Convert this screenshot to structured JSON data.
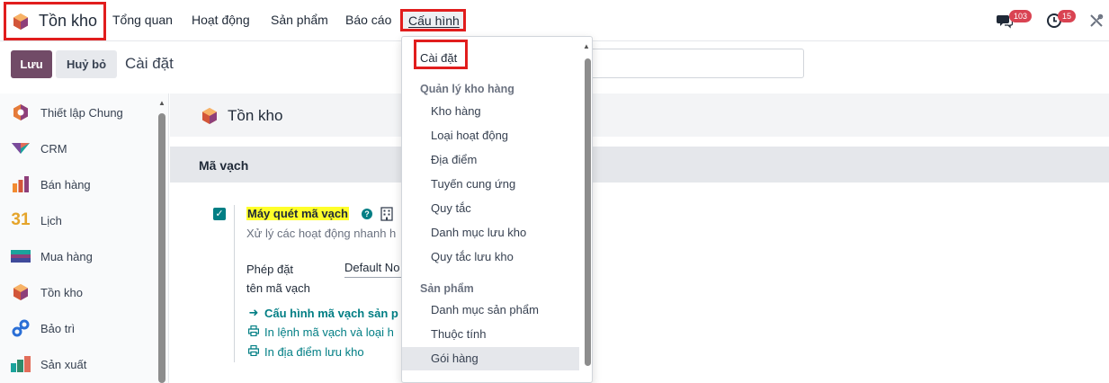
{
  "topbar": {
    "app_name": "Tồn kho",
    "menu": [
      "Tổng quan",
      "Hoạt động",
      "Sản phẩm",
      "Báo cáo"
    ],
    "config_menu": "Cấu hình",
    "messages_count": "103",
    "activities_count": "15",
    "messages_icon": "chat-bubbles-icon",
    "activities_icon": "clock-icon",
    "debug_icon": "tools-icon"
  },
  "controlbar": {
    "save_label": "Lưu",
    "discard_label": "Huỷ bỏ",
    "title": "Cài đặt",
    "search_placeholder": ""
  },
  "sidebar": {
    "items": [
      {
        "label": "Thiết lập Chung",
        "icon": "settings-hex-icon"
      },
      {
        "label": "CRM",
        "icon": "crm-icon"
      },
      {
        "label": "Bán hàng",
        "icon": "sales-chart-icon"
      },
      {
        "label": "Lịch",
        "icon": "calendar-31-icon",
        "icon_text": "31"
      },
      {
        "label": "Mua hàng",
        "icon": "purchase-icon"
      },
      {
        "label": "Tồn kho",
        "icon": "inventory-cube-icon"
      },
      {
        "label": "Bảo trì",
        "icon": "maintenance-icon"
      },
      {
        "label": "Sản xuất",
        "icon": "manufacturing-icon"
      }
    ]
  },
  "main": {
    "app_title": "Tồn kho",
    "section_title": "Mã vạch",
    "setting": {
      "title": "Máy quét mã vạch",
      "description": "Xử lý các hoạt động nhanh h",
      "checked": true,
      "field_label_1": "Phép đặt",
      "field_label_2": "tên mã vạch",
      "field_value": "Default No",
      "links": [
        {
          "text": "Cấu hình mã vạch sản p",
          "icon": "arrow-right-icon",
          "bold": true
        },
        {
          "text": "In lệnh mã vạch và loại h",
          "icon": "printer-icon",
          "bold": false
        },
        {
          "text": "In địa điểm lưu kho",
          "icon": "printer-icon",
          "bold": false
        }
      ]
    }
  },
  "dropdown": {
    "settings_item": "Cài đặt",
    "groups": [
      {
        "header": "Quản lý kho hàng",
        "items": [
          "Kho hàng",
          "Loại hoạt động",
          "Địa điểm",
          "Tuyến cung ứng",
          "Quy tắc",
          "Danh mục lưu kho",
          "Quy tắc lưu kho"
        ]
      },
      {
        "header": "Sản phẩm",
        "items": [
          "Danh mục sản phẩm",
          "Thuộc tính",
          "Gói hàng"
        ]
      }
    ],
    "active_item": "Gói hàng"
  },
  "colors": {
    "primary": "#714b67",
    "accent_teal": "#017e84",
    "highlight_red": "#e11d1d",
    "badge_red": "#d94352"
  }
}
